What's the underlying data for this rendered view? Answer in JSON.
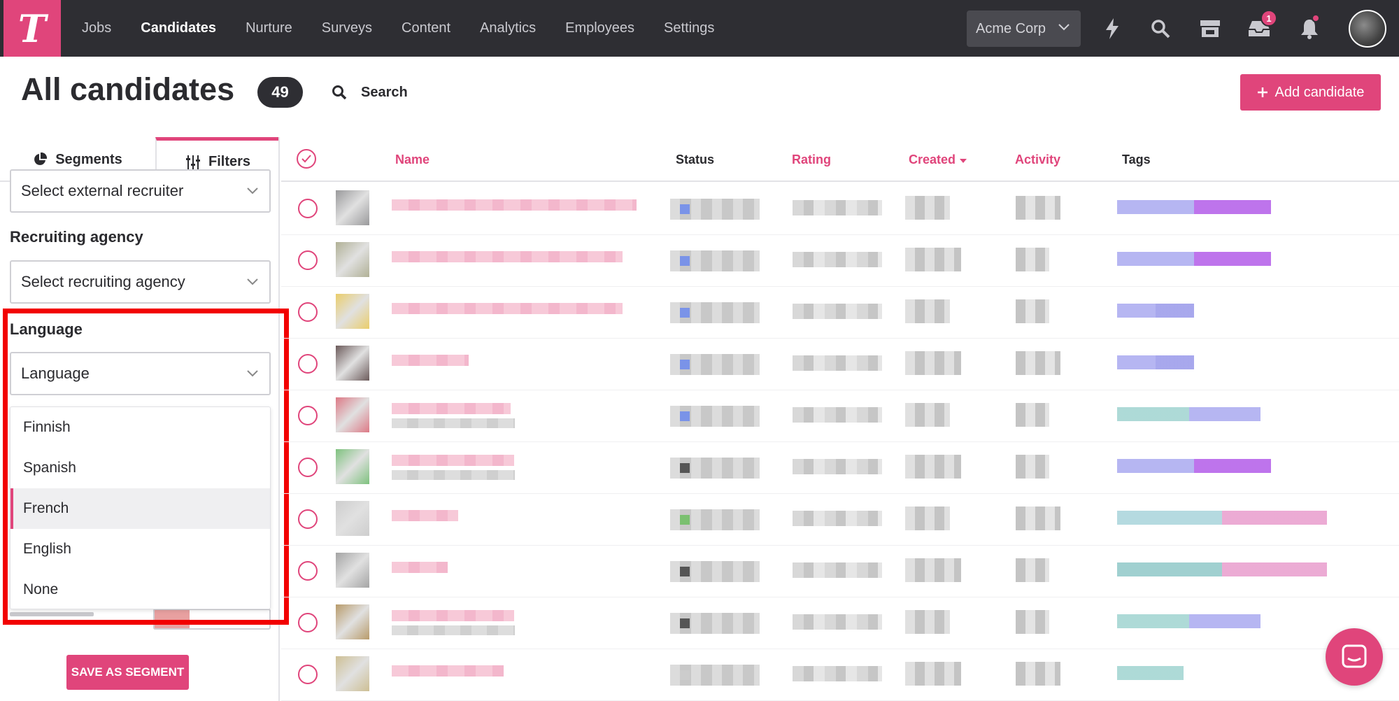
{
  "nav": {
    "logo": "T",
    "items": [
      "Jobs",
      "Candidates",
      "Nurture",
      "Surveys",
      "Content",
      "Analytics",
      "Employees",
      "Settings"
    ],
    "active": "Candidates",
    "company": "Acme Corp",
    "inbox_badge": "1"
  },
  "header": {
    "title": "All candidates",
    "count": "49",
    "search_label": "Search",
    "add_button": "Add candidate"
  },
  "sidebar": {
    "tab_segments": "Segments",
    "tab_filters": "Filters",
    "external_recruiter_placeholder": "Select external recruiter",
    "recruiting_agency_label": "Recruiting agency",
    "recruiting_agency_placeholder": "Select recruiting agency",
    "language_label": "Language",
    "language_value": "Language",
    "language_options": [
      "Finnish",
      "Spanish",
      "French",
      "English",
      "None"
    ],
    "language_hovered": "French",
    "save_segment": "SAVE AS SEGMENT"
  },
  "table": {
    "columns": [
      "Name",
      "Status",
      "Rating",
      "Created",
      "Activity",
      "Tags"
    ],
    "sorted_column": "Created",
    "row_count": 10
  },
  "colors": {
    "brand": "#e0457b",
    "topbar": "#2e2e33",
    "highlight": "#f20000"
  },
  "icons": [
    "bolt-icon",
    "search-icon",
    "store-icon",
    "inbox-icon",
    "bell-icon",
    "chat-icon",
    "pie-chart-icon",
    "sliders-icon",
    "plus-icon",
    "chevron-down-icon"
  ]
}
